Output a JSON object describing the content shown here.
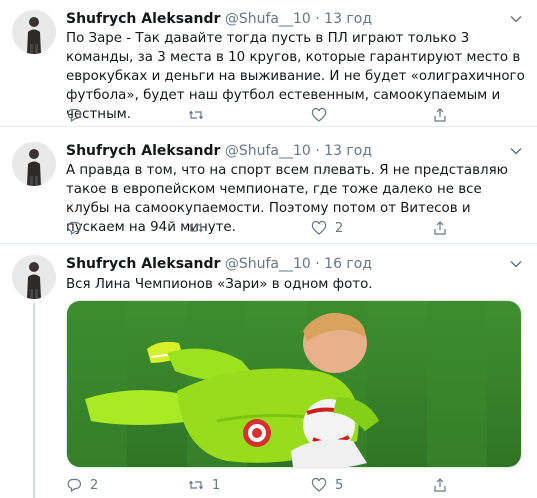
{
  "tweets": [
    {
      "name": "Shufrych Aleksandr",
      "handle": "@Shufa__10",
      "dot": "·",
      "time": "13 год",
      "text": "По Заре - Так давайте тогда пусть в ПЛ играют только 3 команды, за 3 места в 10 кругов, которые  гарантируют место в еврокубках и деньги на выживание. И не будет «олиграхичного футбола», будет наш футбол естевенным, самоокупаемым и честным.",
      "reply_count": "",
      "retweet_count": "",
      "like_count": ""
    },
    {
      "name": "Shufrych Aleksandr",
      "handle": "@Shufa__10",
      "dot": "·",
      "time": "13 год",
      "text": "А правда в том, что на спорт всем плевать. Я не представляю такое в европейском чемпионате, где тоже далеко не все клубы на самоокупаемости. Поэтому потом от Витесов и пускаем на 94й минуте.",
      "reply_count": "",
      "retweet_count": "",
      "like_count": "2"
    },
    {
      "name": "Shufrych Aleksandr",
      "handle": "@Shufa__10",
      "dot": "·",
      "time": "16 год",
      "text": "Вся Лина Чемпионов «Зари» в одном фото.",
      "reply_count": "2",
      "retweet_count": "1",
      "like_count": "5"
    }
  ],
  "icons": {
    "reply": "reply-icon",
    "retweet": "retweet-icon",
    "like": "heart-icon",
    "share": "share-icon",
    "more": "chevron-down-icon"
  },
  "colors": {
    "text": "#14171a",
    "secondary": "#657786",
    "divider": "#e6ecf0",
    "pitch": "#3d8a2e",
    "kit": "#9de21f"
  }
}
